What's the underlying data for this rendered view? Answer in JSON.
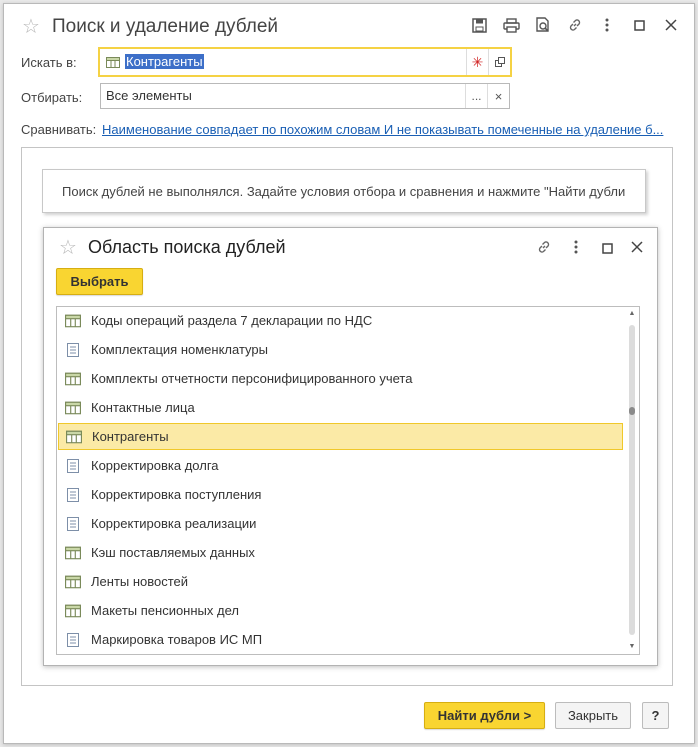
{
  "window": {
    "title": "Поиск и удаление дублей",
    "toolbar_icons": [
      "save-icon",
      "print-icon",
      "preview-icon",
      "link-icon",
      "more-icon",
      "maximize-icon",
      "close-icon"
    ]
  },
  "form": {
    "search_in_label": "Искать в:",
    "search_in_value": "Контрагенты",
    "filter_label": "Отбирать:",
    "filter_value": "Все элементы",
    "filter_select_button": "...",
    "filter_clear_button": "×",
    "compare_label": "Сравнивать:",
    "compare_link": "Наименование совпадает по похожим словам И не показывать помеченные на удаление б..."
  },
  "notice": {
    "text": "Поиск дублей не выполнялся.  Задайте условия отбора и сравнения и нажмите \"Найти дубли"
  },
  "dialog": {
    "title": "Область поиска дублей",
    "choose_button": "Выбрать",
    "items": [
      {
        "label": "Коды операций раздела 7 декларации по НДС",
        "icon": "catalog-icon",
        "selected": false
      },
      {
        "label": "Комплектация номенклатуры",
        "icon": "document-icon",
        "selected": false
      },
      {
        "label": "Комплекты отчетности персонифицированного учета",
        "icon": "catalog-icon",
        "selected": false
      },
      {
        "label": "Контактные лица",
        "icon": "catalog-icon",
        "selected": false
      },
      {
        "label": "Контрагенты",
        "icon": "catalog-icon",
        "selected": true
      },
      {
        "label": "Корректировка долга",
        "icon": "document-icon",
        "selected": false
      },
      {
        "label": "Корректировка поступления",
        "icon": "document-icon",
        "selected": false
      },
      {
        "label": "Корректировка реализации",
        "icon": "document-icon",
        "selected": false
      },
      {
        "label": "Кэш поставляемых данных",
        "icon": "catalog-icon",
        "selected": false
      },
      {
        "label": "Ленты новостей",
        "icon": "catalog-icon",
        "selected": false
      },
      {
        "label": "Макеты пенсионных дел",
        "icon": "catalog-icon",
        "selected": false
      },
      {
        "label": "Маркировка товаров ИС МП",
        "icon": "document-icon",
        "selected": false
      }
    ]
  },
  "footer": {
    "find_button": "Найти дубли >",
    "close_button": "Закрыть",
    "help_button": "?"
  },
  "colors": {
    "accent_yellow": "#f9d531",
    "selection_bg": "#fbeaa6",
    "link_blue": "#1a5fb4",
    "text_selection": "#3d6fc8"
  }
}
